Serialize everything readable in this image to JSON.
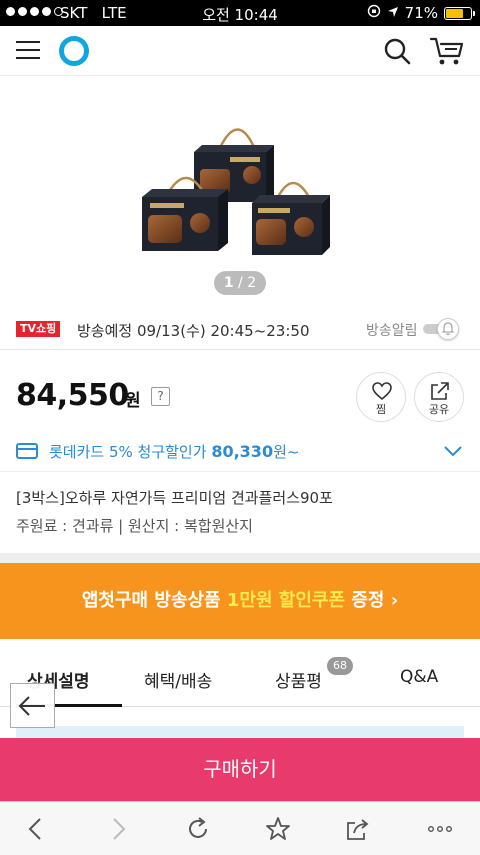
{
  "status_bar": {
    "carrier": "SKT",
    "network": "LTE",
    "time": "오전 10:44",
    "battery": "71%",
    "battery_level": 0.71,
    "battery_color": "#f3c000"
  },
  "header": {
    "menu_icon": "hamburger-menu-icon",
    "logo_icon": "ring-logo-icon",
    "search_icon": "search-icon",
    "cart_icon": "cart-icon",
    "brand_color": "#11a6e0"
  },
  "gallery": {
    "current": "1",
    "separator": "/",
    "total": "2"
  },
  "broadcast": {
    "badge": "TV쇼핑",
    "schedule": "방송예정 09/13(수) 20:45~23:50",
    "alarm_label": "방송알림",
    "alarm_on": false
  },
  "price": {
    "amount": "84,550",
    "unit": "원",
    "help": "?"
  },
  "actions": {
    "wish_label": "찜",
    "share_label": "공유"
  },
  "card_promo": {
    "text": "롯데카드 5% 청구할인가",
    "price": "80,330",
    "suffix": "원~",
    "color": "#2a8bd6"
  },
  "product": {
    "title": "[3박스]오하루 자연가득 프리미엄 견과플러스90포",
    "meta": "주원료 : 견과류 | 원산지 : 복합원산지"
  },
  "banner": {
    "prefix": "앱첫구매 방송상품 ",
    "highlight": "1만원 할인쿠폰",
    "suffix": " 증정 ›",
    "bg": "#f7941d"
  },
  "tabs": [
    {
      "label": "상세설명",
      "active": true
    },
    {
      "label": "혜택/배송",
      "active": false
    },
    {
      "label": "상품평",
      "active": false,
      "badge": "68"
    },
    {
      "label": "Q&A",
      "active": false
    }
  ],
  "buy_button": {
    "label": "구매하기",
    "color": "#e83a6c"
  },
  "browser_toolbar": {
    "back_icon": "chevron-left-icon",
    "forward_icon": "chevron-right-icon",
    "reload_icon": "reload-icon",
    "bookmark_icon": "star-icon",
    "share_icon": "share-icon",
    "more_icon": "more-dots-icon"
  }
}
